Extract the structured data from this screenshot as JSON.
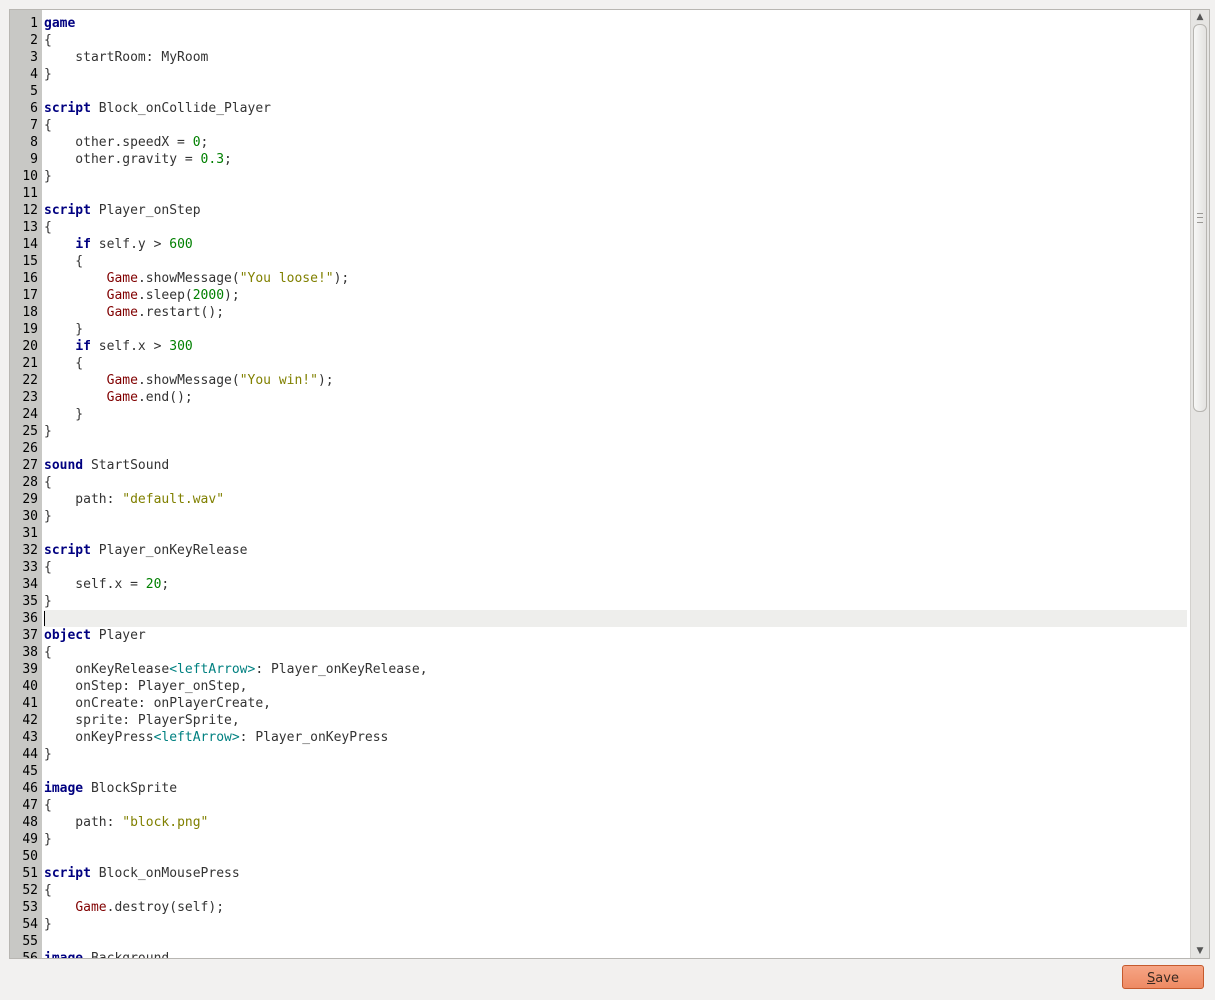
{
  "toolbar": {
    "save_label_mnemonic": "S",
    "save_label_rest": "ave"
  },
  "editor": {
    "current_line": 36,
    "lines": [
      [
        [
          "kw",
          "game"
        ]
      ],
      [
        [
          "plain",
          "{"
        ]
      ],
      [
        [
          "plain",
          "    startRoom: MyRoom"
        ]
      ],
      [
        [
          "plain",
          "}"
        ]
      ],
      [],
      [
        [
          "kw",
          "script"
        ],
        [
          "plain",
          " Block_onCollide_Player"
        ]
      ],
      [
        [
          "plain",
          "{"
        ]
      ],
      [
        [
          "plain",
          "    other.speedX = "
        ],
        [
          "num",
          "0"
        ],
        [
          "plain",
          ";"
        ]
      ],
      [
        [
          "plain",
          "    other.gravity = "
        ],
        [
          "num",
          "0.3"
        ],
        [
          "plain",
          ";"
        ]
      ],
      [
        [
          "plain",
          "}"
        ]
      ],
      [],
      [
        [
          "kw",
          "script"
        ],
        [
          "plain",
          " Player_onStep"
        ]
      ],
      [
        [
          "plain",
          "{"
        ]
      ],
      [
        [
          "plain",
          "    "
        ],
        [
          "kw",
          "if"
        ],
        [
          "plain",
          " self.y > "
        ],
        [
          "num",
          "600"
        ]
      ],
      [
        [
          "plain",
          "    {"
        ]
      ],
      [
        [
          "plain",
          "        "
        ],
        [
          "cls",
          "Game"
        ],
        [
          "plain",
          ".showMessage("
        ],
        [
          "str",
          "\"You loose!\""
        ],
        [
          "plain",
          ");"
        ]
      ],
      [
        [
          "plain",
          "        "
        ],
        [
          "cls",
          "Game"
        ],
        [
          "plain",
          ".sleep("
        ],
        [
          "num",
          "2000"
        ],
        [
          "plain",
          ");"
        ]
      ],
      [
        [
          "plain",
          "        "
        ],
        [
          "cls",
          "Game"
        ],
        [
          "plain",
          ".restart();"
        ]
      ],
      [
        [
          "plain",
          "    }"
        ]
      ],
      [
        [
          "plain",
          "    "
        ],
        [
          "kw",
          "if"
        ],
        [
          "plain",
          " self.x > "
        ],
        [
          "num",
          "300"
        ]
      ],
      [
        [
          "plain",
          "    {"
        ]
      ],
      [
        [
          "plain",
          "        "
        ],
        [
          "cls",
          "Game"
        ],
        [
          "plain",
          ".showMessage("
        ],
        [
          "str",
          "\"You win!\""
        ],
        [
          "plain",
          ");"
        ]
      ],
      [
        [
          "plain",
          "        "
        ],
        [
          "cls",
          "Game"
        ],
        [
          "plain",
          ".end();"
        ]
      ],
      [
        [
          "plain",
          "    }"
        ]
      ],
      [
        [
          "plain",
          "}"
        ]
      ],
      [],
      [
        [
          "kw",
          "sound"
        ],
        [
          "plain",
          " StartSound"
        ]
      ],
      [
        [
          "plain",
          "{"
        ]
      ],
      [
        [
          "plain",
          "    path: "
        ],
        [
          "str",
          "\"default.wav\""
        ]
      ],
      [
        [
          "plain",
          "}"
        ]
      ],
      [],
      [
        [
          "kw",
          "script"
        ],
        [
          "plain",
          " Player_onKeyRelease"
        ]
      ],
      [
        [
          "plain",
          "{"
        ]
      ],
      [
        [
          "plain",
          "    self.x = "
        ],
        [
          "num",
          "20"
        ],
        [
          "plain",
          ";"
        ]
      ],
      [
        [
          "plain",
          "}"
        ]
      ],
      [],
      [
        [
          "kw",
          "object"
        ],
        [
          "plain",
          " Player"
        ]
      ],
      [
        [
          "plain",
          "{"
        ]
      ],
      [
        [
          "plain",
          "    onKeyRelease"
        ],
        [
          "ev",
          "<leftArrow>"
        ],
        [
          "plain",
          ": Player_onKeyRelease,"
        ]
      ],
      [
        [
          "plain",
          "    onStep: Player_onStep,"
        ]
      ],
      [
        [
          "plain",
          "    onCreate: onPlayerCreate,"
        ]
      ],
      [
        [
          "plain",
          "    sprite: PlayerSprite,"
        ]
      ],
      [
        [
          "plain",
          "    onKeyPress"
        ],
        [
          "ev",
          "<leftArrow>"
        ],
        [
          "plain",
          ": Player_onKeyPress"
        ]
      ],
      [
        [
          "plain",
          "}"
        ]
      ],
      [],
      [
        [
          "kw",
          "image"
        ],
        [
          "plain",
          " BlockSprite"
        ]
      ],
      [
        [
          "plain",
          "{"
        ]
      ],
      [
        [
          "plain",
          "    path: "
        ],
        [
          "str",
          "\"block.png\""
        ]
      ],
      [
        [
          "plain",
          "}"
        ]
      ],
      [],
      [
        [
          "kw",
          "script"
        ],
        [
          "plain",
          " Block_onMousePress"
        ]
      ],
      [
        [
          "plain",
          "{"
        ]
      ],
      [
        [
          "plain",
          "    "
        ],
        [
          "cls",
          "Game"
        ],
        [
          "plain",
          ".destroy(self);"
        ]
      ],
      [
        [
          "plain",
          "}"
        ]
      ],
      [],
      [
        [
          "kw",
          "image"
        ],
        [
          "plain",
          " Background"
        ]
      ]
    ]
  },
  "colors": {
    "keyword": "#000080",
    "number": "#008000",
    "string": "#808000",
    "class": "#800000",
    "event": "#008080",
    "save_button": "#ee8a63"
  },
  "icons": {
    "scroll_up": "triangle-up",
    "scroll_down": "triangle-down"
  }
}
